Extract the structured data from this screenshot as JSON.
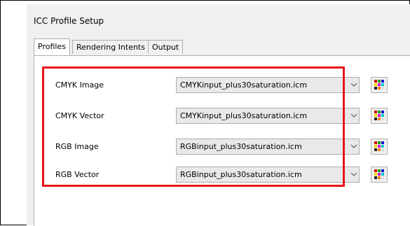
{
  "dialog": {
    "title": "ICC Profile Setup"
  },
  "tabs": [
    {
      "label": "Profiles",
      "active": true
    },
    {
      "label": "Rendering Intents",
      "active": false
    },
    {
      "label": "Output",
      "active": false
    }
  ],
  "profiles": [
    {
      "label": "CMYK Image",
      "value": "CMYKinput_plus30saturation.icm"
    },
    {
      "label": "CMYK Vector",
      "value": "CMYKinput_plus30saturation.icm"
    },
    {
      "label": "RGB Image",
      "value": "RGBinput_plus30saturation.icm"
    },
    {
      "label": "RGB Vector",
      "value": "RGBinput_plus30saturation.icm"
    }
  ],
  "colors": {
    "highlight": "#e8141b",
    "panel": "#ffffff",
    "window": "#f0f0f0"
  }
}
